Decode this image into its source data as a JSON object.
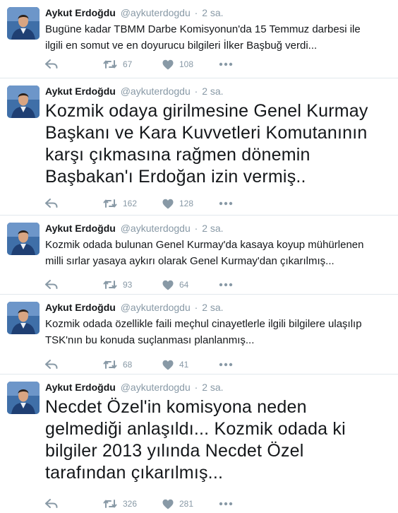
{
  "tweets": [
    {
      "name": "Aykut Erdoğdu",
      "handle": "@aykuterdogdu",
      "separator": "·",
      "time": "2 sa.",
      "size": "small",
      "lines": [
        "Bugüne kadar TBMM Darbe Komisyonun'da 15 Temmuz darbesi ile",
        "ilgili en somut ve en doyurucu bilgileri İlker Başbuğ verdi..."
      ],
      "retweets": "67",
      "likes": "108"
    },
    {
      "name": "Aykut Erdoğdu",
      "handle": "@aykuterdogdu",
      "separator": "·",
      "time": "2 sa.",
      "size": "big",
      "lines": [
        "Kozmik odaya girilmesine Genel Kurmay",
        "Başkanı ve Kara Kuvvetleri Komutanının",
        "karşı çıkmasına rağmen dönemin",
        "Başbakan'ı Erdoğan izin vermiş.."
      ],
      "retweets": "162",
      "likes": "128"
    },
    {
      "name": "Aykut Erdoğdu",
      "handle": "@aykuterdogdu",
      "separator": "·",
      "time": "2 sa.",
      "size": "small",
      "lines": [
        "Kozmik odada bulunan Genel Kurmay'da kasaya koyup mühürlenen",
        "milli sırlar yasaya aykırı olarak Genel Kurmay'dan çıkarılmış..."
      ],
      "retweets": "93",
      "likes": "64"
    },
    {
      "name": "Aykut Erdoğdu",
      "handle": "@aykuterdogdu",
      "separator": "·",
      "time": "2 sa.",
      "size": "small",
      "lines": [
        "Kozmik odada özellikle faili meçhul cinayetlerle ilgili bilgilere ulaşılıp",
        "TSK'nın bu konuda suçlanması planlanmış..."
      ],
      "retweets": "68",
      "likes": "41"
    },
    {
      "name": "Aykut Erdoğdu",
      "handle": "@aykuterdogdu",
      "separator": "·",
      "time": "2 sa.",
      "size": "big",
      "lines": [
        "Necdet Özel'in komisyona neden",
        "gelmediği anlaşıldı... Kozmik odada ki",
        "bilgiler 2013 yılında Necdet Özel",
        "tarafından çıkarılmış..."
      ],
      "retweets": "326",
      "likes": "281"
    }
  ],
  "icons": {
    "reply": "reply-icon",
    "retweet": "retweet-icon",
    "like": "heart-icon",
    "more": "more-icon"
  },
  "colors": {
    "icon_gray": "#8899a6",
    "divider": "#e1e8ed",
    "text": "#14171a"
  }
}
